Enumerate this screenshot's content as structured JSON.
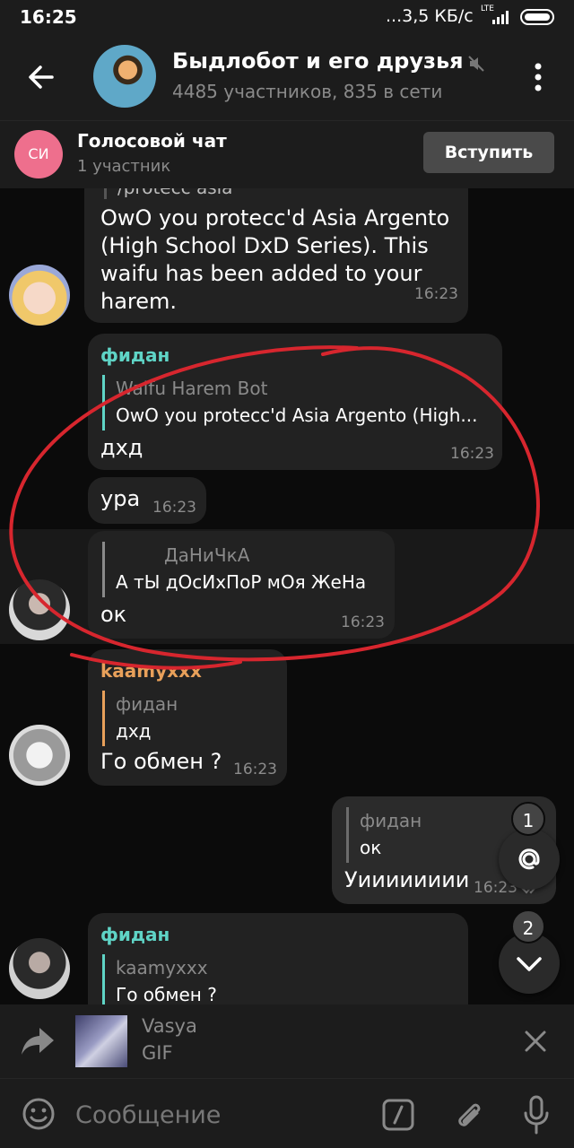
{
  "status": {
    "time": "16:25",
    "speed": "...3,5 КБ/с",
    "network": "LTE"
  },
  "header": {
    "title": "Быдлобот и его друзья",
    "subtitle": "4485 участников, 835 в сети"
  },
  "voice_chat": {
    "avatar_initials": "СИ",
    "title": "Голосовой чат",
    "subtitle": "1 участник",
    "join_label": "Вступить"
  },
  "messages": [
    {
      "top_quote": "/protecc asia",
      "lines": [
        "OwO you protecc'd Asia Argento",
        "(High School DxD Series). This",
        "waifu has been added to your",
        "harem."
      ],
      "time": "16:23"
    },
    {
      "sender": "фидан",
      "quote_name": "Waifu Harem Bot",
      "quote_text": "OwO you protecc'd Asia Argento (High...",
      "text": "дхд",
      "time": "16:23"
    },
    {
      "text": "ура",
      "time": "16:23"
    },
    {
      "quote_name": "ДаНиЧкА",
      "quote_text": "А тЫ дОсИхПоР мОя ЖеНа",
      "text": "ок",
      "time": "16:23"
    },
    {
      "sender": "kaamyxxx",
      "quote_name": "фидан",
      "quote_text": "дхд",
      "text": "Го обмен ?",
      "time": "16:23"
    },
    {
      "quote_name": "фидан",
      "quote_text": "ок",
      "text": "Уииииииии",
      "time": "16:23"
    },
    {
      "sender": "фидан",
      "quote_name": "kaamyxxx",
      "quote_text": "Го обмен ?"
    }
  ],
  "fab": {
    "mention_count": "1",
    "unread_count": "2"
  },
  "forward": {
    "name": "Vasya",
    "type": "GIF"
  },
  "composer": {
    "placeholder": "Сообщение",
    "value": ""
  },
  "colors": {
    "background": "#0b0b0b",
    "bar": "#1c1c1c",
    "bubble": "#222222",
    "sender_fidan": "#5fd4c6",
    "sender_kaamyxxx": "#e8a05a",
    "annotation_circle": "#d7262e",
    "voice_avatar": "#ee6f8d"
  }
}
